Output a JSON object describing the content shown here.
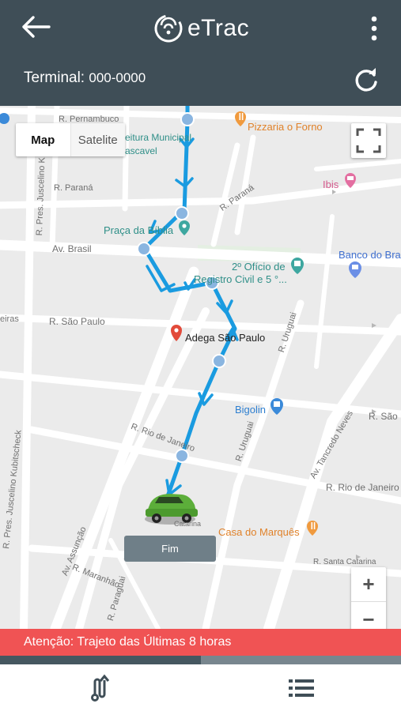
{
  "app": {
    "name": "eTrac"
  },
  "header": {
    "back_icon": "arrow-back-icon",
    "logo_icon": "etrac-signal-logo-icon",
    "menu_icon": "more-vert-icon",
    "terminal_label": "Terminal:",
    "terminal_number": "000-0000",
    "refresh_icon": "refresh-icon"
  },
  "map": {
    "type_toggle": {
      "map_label": "Map",
      "satellite_label": "Satelite",
      "selected": "Map"
    },
    "fullscreen_icon": "fullscreen-icon",
    "zoom_in_label": "+",
    "zoom_out_label": "−",
    "end_button_label": "Fim",
    "route_color": "#1a9be0",
    "pois": [
      {
        "name": "Pizzaria o Forno",
        "icon": "restaurant-icon"
      },
      {
        "name": "Ibis",
        "icon": "hotel-icon"
      },
      {
        "name": "Praça da Bíblia",
        "icon": "place-icon"
      },
      {
        "name": "Banco do Bra",
        "icon": "bank-icon"
      },
      {
        "name": "2º Ofício de",
        "icon": "civic-icon"
      },
      {
        "name": "Registro Civil e 5 °...",
        "icon": ""
      },
      {
        "name": "Adega São Paulo",
        "icon": "red-pin-icon"
      },
      {
        "name": "Bigolin",
        "icon": "shopping-icon"
      },
      {
        "name": "Casa do Marquês",
        "icon": "restaurant-icon"
      },
      {
        "name": "eitura Municipal",
        "icon": ""
      },
      {
        "name": "ascavel",
        "icon": ""
      }
    ],
    "street_labels": {
      "r_pernambuco": "R. Pernambuco",
      "r_parana_left": "R. Paraná",
      "r_parana_right": "R. Paraná",
      "av_brasil": "Av. Brasil",
      "r_sao_paulo": "R. São Paulo",
      "eiras": "eiras",
      "r_uruguai": "R. Uruguai",
      "r_uruguai_2": "R. Uruguai",
      "r_rio_de_janeiro": "R. Rio de Janeiro",
      "r_rio_de_janeiro_2": "R. Rio de Janeiro",
      "r_sao_p_right": "R. São P",
      "av_tancredo_neves": "Av. Tancredo Neves",
      "r_pres_juscelino_k": "R. Pres. Juscelino K",
      "r_pres_juscelino_kubitscheck": "R. Pres. Juscelino Kubitscheck",
      "av_assuncao": "Av. Assunção",
      "r_maranhao": "R. Maranhão",
      "r_paraguai": "R. Paraguai",
      "r_santa_catarina": "R. Santa Catarina",
      "catarina": "Catarina"
    }
  },
  "alert": {
    "text": "Atenção: Trajeto das Últimas 8 horas"
  },
  "progress": {
    "fraction": 0.5
  },
  "bottom_nav": {
    "route_icon": "route-icon",
    "list_icon": "list-icon"
  }
}
